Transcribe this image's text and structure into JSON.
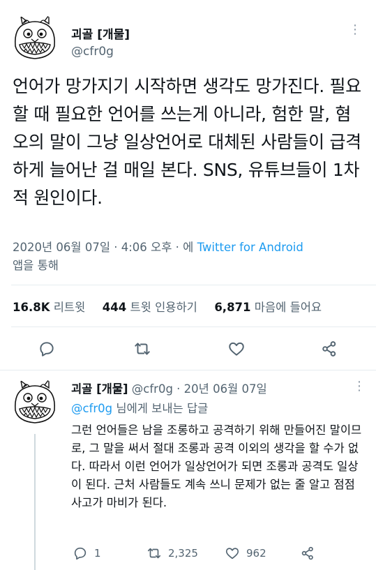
{
  "main_tweet": {
    "author_name": "괴골 [개물]",
    "handle": "@cfr0g",
    "text": "언어가 망가지기 시작하면 생각도 망가진다. 필요할 때 필요한 언어를 쓰는게 아니라, 험한 말, 혐오의 말이 그냥 일상언어로 대체된 사람들이 급격하게 늘어난 걸 매일 본다. SNS, 유튜브들이 1차적 원인이다.",
    "timestamp": "2020년 06월 07일 · 4:06 오후 · 에",
    "via_link": "Twitter for Android",
    "via_suffix": "앱을 통해",
    "stats": {
      "retweets_value": "16.8K",
      "retweets_label": "리트윗",
      "quotes_value": "444",
      "quotes_label": "트윗 인용하기",
      "likes_value": "6,871",
      "likes_label": "마음에 들어요"
    },
    "more_icon": "more-dots-icon"
  },
  "reply_tweet": {
    "author_name": "괴골 [개물]",
    "handle_date": "@cfr0g · 20년 06월 07일",
    "replying_to_handle": "@cfr0g",
    "replying_to_suffix": "님에게 보내는 답글",
    "text": "그런 언어들은 남을 조롱하고 공격하기 위해 만들어진 말이므로, 그 말을 써서 절대 조롱과 공격 이외의 생각을 할 수가 없다. 따라서 이런 언어가 일상언어가 되면 조롱과 공격도 일상이 된다. 근처 사람들도 계속 쓰니 문제가 없는 줄 알고 점점 사고가 마비가 된다.",
    "reply_count": "1",
    "retweet_count": "2,325",
    "like_count": "962"
  },
  "colors": {
    "text": "#0f1419",
    "secondary": "#536471",
    "link": "#1d9bf0",
    "divider": "#e6ecf0",
    "icon": "#536471"
  }
}
